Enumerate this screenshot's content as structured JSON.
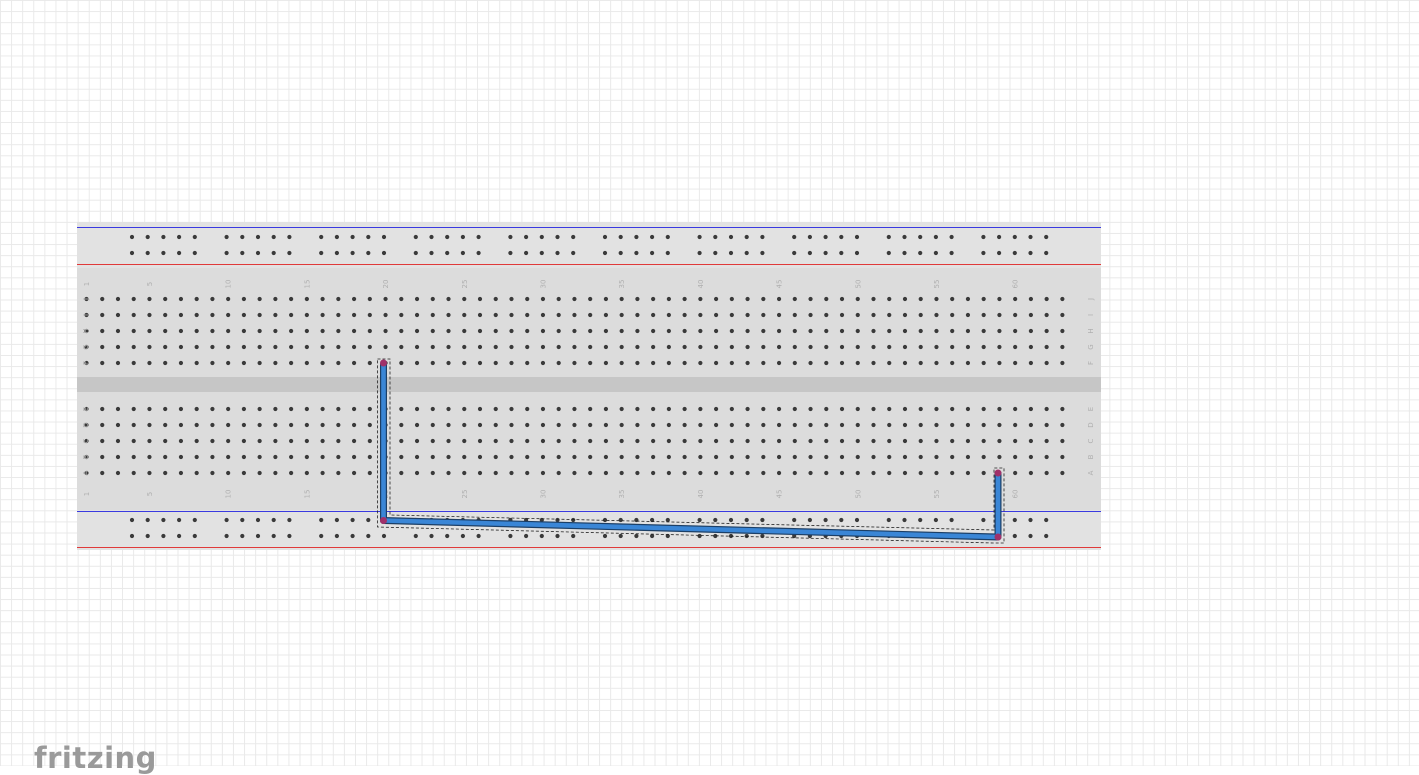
{
  "app": {
    "logo_text": "fritzing"
  },
  "breadboard": {
    "columns": 63,
    "column_labels": [
      "1",
      "5",
      "10",
      "15",
      "20",
      "25",
      "30",
      "35",
      "40",
      "45",
      "50",
      "55",
      "60"
    ],
    "column_label_numbers": [
      1,
      5,
      10,
      15,
      20,
      25,
      30,
      35,
      40,
      45,
      50,
      55,
      60
    ],
    "top_rows": [
      "J",
      "I",
      "H",
      "G",
      "F"
    ],
    "bottom_rows": [
      "E",
      "D",
      "C",
      "B",
      "A"
    ],
    "rail_groups": 10,
    "rail_holes_per_group": 5,
    "colors": {
      "body": "#dcdcdc",
      "center_channel": "#c6c6c6",
      "rail_body": "#e4e4e4",
      "negative_line": "#3a3ae0",
      "positive_line": "#e03a3a",
      "hole": "#3a3a3a",
      "label": "#b0b0b0"
    }
  },
  "wire": {
    "color": "#3a86d6",
    "outline": "#1c3f66",
    "endpoint_color": "#a0316a",
    "connections": [
      {
        "from": "F19",
        "to": "negative-rail-bottom"
      },
      {
        "from": "negative-rail-bottom",
        "to": "positive-rail-bottom"
      },
      {
        "from": "positive-rail-bottom",
        "to": "A58"
      }
    ],
    "selected": true
  }
}
